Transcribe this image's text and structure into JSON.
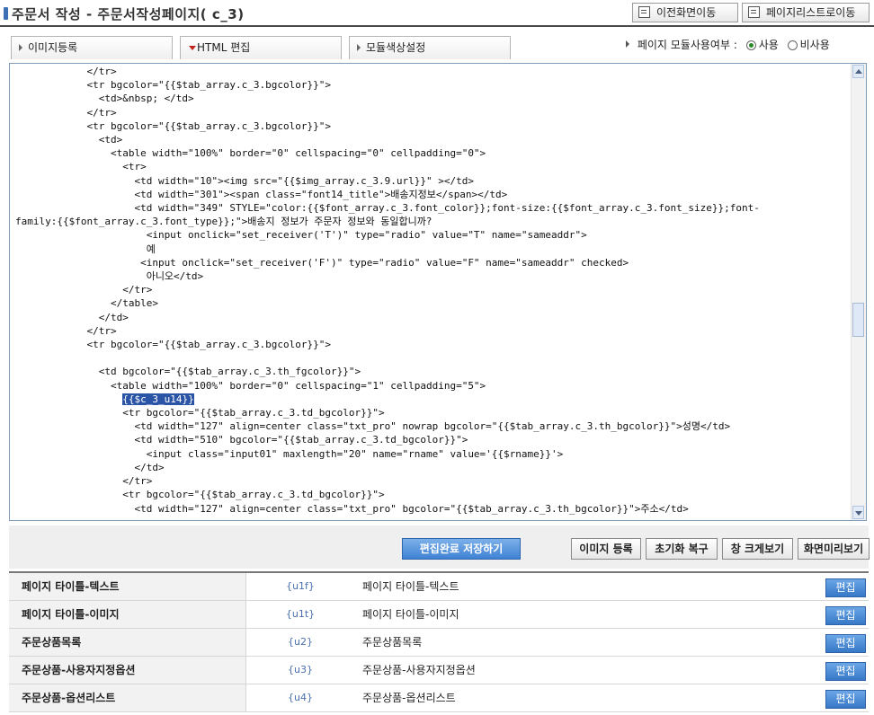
{
  "header": {
    "title": "주문서 작성 - 주문서작성페이지( c_3)",
    "prev_button": "이전화면이동",
    "list_button": "페이지리스트로이동"
  },
  "tabs": [
    {
      "label": "이미지등록"
    },
    {
      "label": "HTML 편집"
    },
    {
      "label": "모듈색상설정"
    }
  ],
  "module_option": {
    "label": "페이지 모듈사용여부 :",
    "use": "사용",
    "not_use": "비사용",
    "selected": "사용"
  },
  "editor": {
    "lines": [
      "            </tr>",
      "            <tr bgcolor=\"{{$tab_array.c_3.bgcolor}}\">",
      "              <td>&nbsp; </td>",
      "            </tr>",
      "            <tr bgcolor=\"{{$tab_array.c_3.bgcolor}}\">",
      "              <td>",
      "                <table width=\"100%\" border=\"0\" cellspacing=\"0\" cellpadding=\"0\">",
      "                  <tr>",
      "                    <td width=\"10\"><img src=\"{{$img_array.c_3.9.url}}\" ></td>",
      "                    <td width=\"301\"><span class=\"font14_title\">배송지정보</span></td>",
      "                    <td width=\"349\" STYLE=\"color:{{$font_array.c_3.font_color}};font-size:{{$font_array.c_3.font_size}};font-",
      "family:{{$font_array.c_3.font_type}};\">배송지 정보가 주문자 정보와 동일합니까?",
      "                      <input onclick=\"set_receiver('T')\" type=\"radio\" value=\"T\" name=\"sameaddr\">",
      "                      예",
      "                     <input onclick=\"set_receiver('F')\" type=\"radio\" value=\"F\" name=\"sameaddr\" checked>",
      "                      아니오</td>",
      "                  </tr>",
      "                </table>",
      "              </td>",
      "            </tr>",
      "            <tr bgcolor=\"{{$tab_array.c_3.bgcolor}}\">",
      "",
      "              <td bgcolor=\"{{$tab_array.c_3.th_fgcolor}}\">",
      "                <table width=\"100%\" border=\"0\" cellspacing=\"1\" cellpadding=\"5\">",
      "                  {{$c_3_u14}}",
      "                  <tr bgcolor=\"{{$tab_array.c_3.td_bgcolor}}\">",
      "                    <td width=\"127\" align=center class=\"txt_pro\" nowrap bgcolor=\"{{$tab_array.c_3.th_bgcolor}}\">성명</td>",
      "                    <td width=\"510\" bgcolor=\"{{$tab_array.c_3.td_bgcolor}}\">",
      "                      <input class=\"input01\" maxlength=\"20\" name=\"rname\" value='{{$rname}}'>",
      "                    </td>",
      "                  </tr>",
      "                  <tr bgcolor=\"{{$tab_array.c_3.td_bgcolor}}\">",
      "                    <td width=\"127\" align=center class=\"txt_pro\" bgcolor=\"{{$tab_array.c_3.th_bgcolor}}\">주소</td>"
    ],
    "highlighted": "{{$c_3_u14}}"
  },
  "buttons": {
    "save": "편집완료 저장하기",
    "image_register": "이미지 등록",
    "reset": "초기화 복구",
    "enlarge": "창 크게보기",
    "preview": "화면미리보기"
  },
  "modules": [
    {
      "name": "페이지 타이틀-텍스트",
      "code": "{u1f}",
      "desc": "페이지 타이틀-텍스트",
      "edit": "편집"
    },
    {
      "name": "페이지 타이틀-이미지",
      "code": "{u1t}",
      "desc": "페이지 타이틀-이미지",
      "edit": "편집"
    },
    {
      "name": "주문상품목록",
      "code": "{u2}",
      "desc": "주문상품목록",
      "edit": "편집"
    },
    {
      "name": "주문상품-사용자지정옵션",
      "code": "{u3}",
      "desc": "주문상품-사용자지정옵션",
      "edit": "편집"
    },
    {
      "name": "주문상품-옵션리스트",
      "code": "{u4}",
      "desc": "주문상품-옵션리스트",
      "edit": "편집"
    }
  ]
}
